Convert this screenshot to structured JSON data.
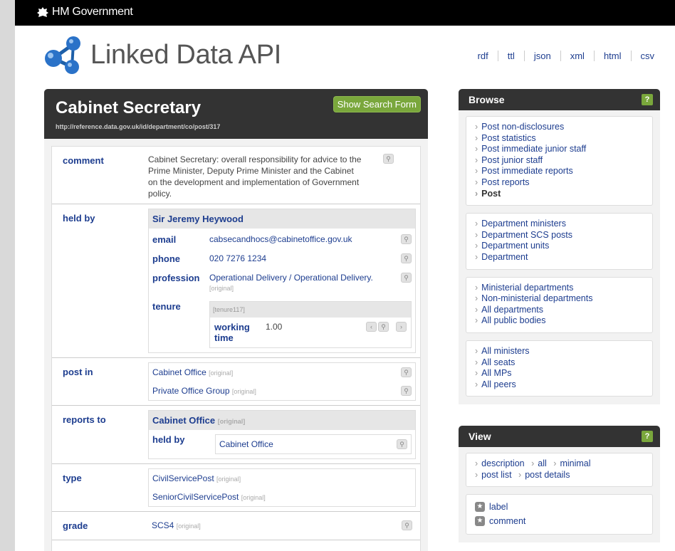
{
  "gov": {
    "brand": "HM Government"
  },
  "app": {
    "title": "Linked Data API"
  },
  "formats": [
    "rdf",
    "ttl",
    "json",
    "xml",
    "html",
    "csv"
  ],
  "main": {
    "title": "Cabinet Secretary",
    "uri": "http://reference.data.gov.uk/id/department/co/post/317",
    "search_button": "Show Search Form",
    "original_tag": "[original]",
    "comment": {
      "label": "comment",
      "value": "Cabinet Secretary: overall responsibility for advice to the Prime Minister, Deputy Prime Minister and the Cabinet on the development and implementation of Government policy."
    },
    "held_by": {
      "label": "held by",
      "name": "Sir Jeremy Heywood",
      "email": {
        "label": "email",
        "value": "cabsecandhocs@cabinetoffice.gov.uk"
      },
      "phone": {
        "label": "phone",
        "value": "020 7276 1234"
      },
      "profession": {
        "label": "profession",
        "value": "Operational Delivery / Operational Delivery."
      },
      "tenure": {
        "label": "tenure",
        "id": "[tenure117]",
        "working_time_label": "working time",
        "working_time": "1.00"
      }
    },
    "post_in": {
      "label": "post in",
      "items": [
        "Cabinet Office",
        "Private Office Group"
      ]
    },
    "reports_to": {
      "label": "reports to",
      "name": "Cabinet Office",
      "held_by_label": "held by",
      "held_by_value": "Cabinet Office"
    },
    "type": {
      "label": "type",
      "items": [
        "CivilServicePost",
        "SeniorCivilServicePost"
      ]
    },
    "grade": {
      "label": "grade",
      "value": "SCS4"
    }
  },
  "browse": {
    "title": "Browse",
    "help": "?",
    "group1": [
      "Post non-disclosures",
      "Post statistics",
      "Post immediate junior staff",
      "Post junior staff",
      "Post immediate reports",
      "Post reports",
      "Post"
    ],
    "group2": [
      "Department ministers",
      "Department SCS posts",
      "Department units",
      "Department"
    ],
    "group3": [
      "Ministerial departments",
      "Non-ministerial departments",
      "All departments",
      "All public bodies"
    ],
    "group4": [
      "All ministers",
      "All seats",
      "All MPs",
      "All peers"
    ]
  },
  "view": {
    "title": "View",
    "help": "?",
    "row1": [
      "description",
      "all",
      "minimal"
    ],
    "row2": [
      "post list",
      "post details"
    ],
    "stars": [
      "label",
      "comment"
    ]
  },
  "colors": {
    "accent": "#7aa73c",
    "link": "#1d3d8f",
    "header": "#333333"
  }
}
